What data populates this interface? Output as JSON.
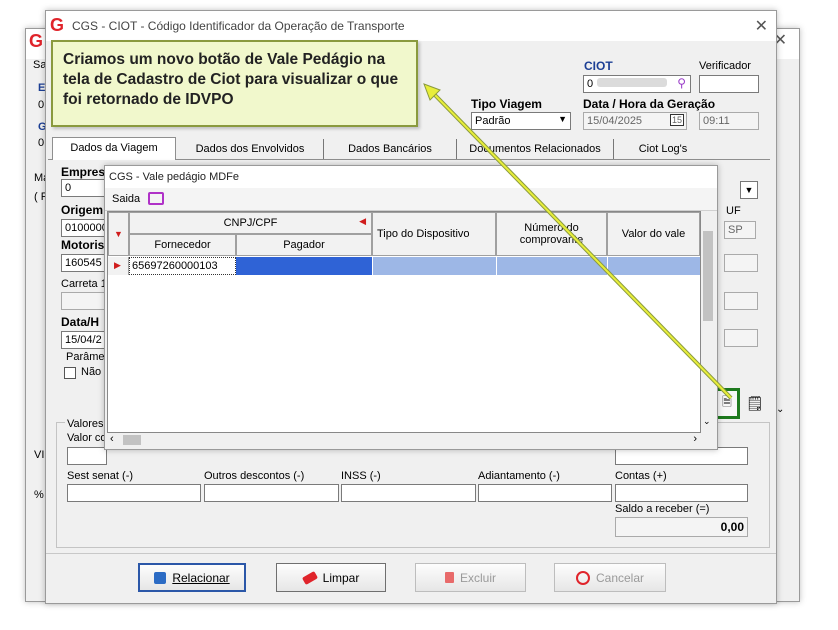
{
  "back_window": {
    "title": "",
    "fragments": [
      "Sa",
      "E",
      "0",
      "G",
      "0",
      "Ma",
      "( F8",
      "VI",
      "%"
    ]
  },
  "main_window": {
    "title": "CGS - CIOT - Código Identificador da Operação de Transporte",
    "logo": "G",
    "ciot_label": "CIOT",
    "ciot_value": "0",
    "verificador_label": "Verificador",
    "tipo_viagem_label": "Tipo Viagem",
    "tipo_viagem_value": "Padrão",
    "data_geracao_label": "Data / Hora da Geração",
    "data_value": "15/04/2025",
    "hora_value": "09:11",
    "tabs": [
      "Dados da Viagem",
      "Dados dos Envolvidos",
      "Dados Bancários",
      "Documentos Relacionados",
      "Ciot Log's"
    ],
    "left_labels": {
      "empresa": "Empres",
      "empresa_value": "0",
      "origem": "Origem",
      "origem_value": "0100000",
      "motorista": "Motorist",
      "motorista_value": "160545",
      "carreta": "Carreta 1",
      "data_hora": "Data/H",
      "data_hora_value": "15/04/2",
      "parametros": "Parâme",
      "nao": "Não"
    },
    "uf_label": "UF",
    "uf_value": "SP",
    "valores_label": "Valores",
    "valor_co_label": "Valor co",
    "sest_senat_label": "Sest senat (-)",
    "outros_descontos_label": "Outros descontos (-)",
    "inss_label": "INSS (-)",
    "adiantamento_label": "Adiantamento (-)",
    "contas_label": "Contas (+)",
    "saldo_label": "Saldo a receber (=)",
    "saldo_value": "0,00",
    "buttons": {
      "relacionar": "Relacionar",
      "limpar": "Limpar",
      "excluir": "Excluir",
      "cancelar": "Cancelar"
    }
  },
  "popup": {
    "title": "CGS - Vale pedágio MDFe",
    "menu_saida": "Saida",
    "columns": {
      "cnpj_cpf": "CNPJ/CPF",
      "fornecedor": "Fornecedor",
      "pagador": "Pagador",
      "tipo_dispositivo": "Tipo do Dispositivo",
      "numero_comprovante": "Número do comprovante",
      "valor_vale": "Valor do vale"
    },
    "rows": [
      {
        "fornecedor": "65697260000103",
        "pagador": "",
        "tipo_dispositivo": "",
        "numero_comprovante": "",
        "valor_vale": ""
      }
    ]
  },
  "callout": {
    "text": "Criamos um novo botão de Vale Pedágio na tela de Cadastro de Ciot para visualizar o que foi retornado de IDVPO"
  },
  "colors": {
    "accent_red": "#e0242b",
    "selection_blue": "#9db7e6",
    "callout_bg": "#f1f8cc",
    "highlight_green": "#1e7a1e",
    "arrow_yellow": "#e8ee3a"
  }
}
